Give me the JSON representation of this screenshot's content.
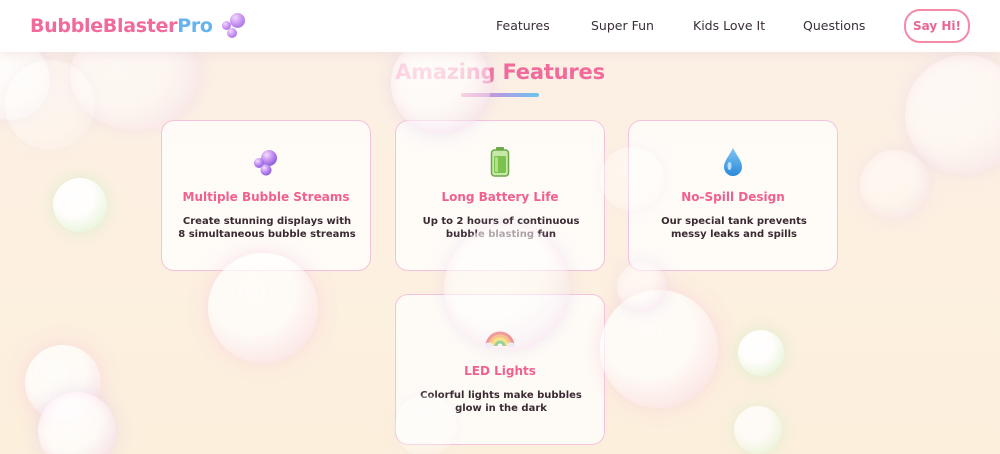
{
  "header": {
    "logo_part1": "BubbleBlaster",
    "logo_part2": "Pro",
    "logo_icon": "bubbles-icon",
    "nav": [
      "Features",
      "Super Fun",
      "Kids Love It",
      "Questions"
    ],
    "cta_label": "Say Hi!"
  },
  "features": {
    "title": "Amazing Features",
    "cards": [
      {
        "icon": "bubbles-icon",
        "title": "Multiple Bubble Streams",
        "desc_line1": "Create stunning displays with",
        "desc_line2": "8 simultaneous bubble streams"
      },
      {
        "icon": "battery-icon",
        "title": "Long Battery Life",
        "desc_line1": "Up to 2 hours of continuous",
        "desc_line2": "bubble blasting fun"
      },
      {
        "icon": "droplet-icon",
        "title": "No-Spill Design",
        "desc_line1": "Our special tank prevents",
        "desc_line2": "messy leaks and spills"
      },
      {
        "icon": "rainbow-icon",
        "title": "LED Lights",
        "desc_line1": "Colorful lights make bubbles",
        "desc_line2": "glow in the dark"
      }
    ]
  },
  "colors": {
    "primary_pink": "#f26a9b",
    "accent_blue": "#66b4ee",
    "card_border": "#f5c2dc",
    "background": "#fcefe2"
  }
}
